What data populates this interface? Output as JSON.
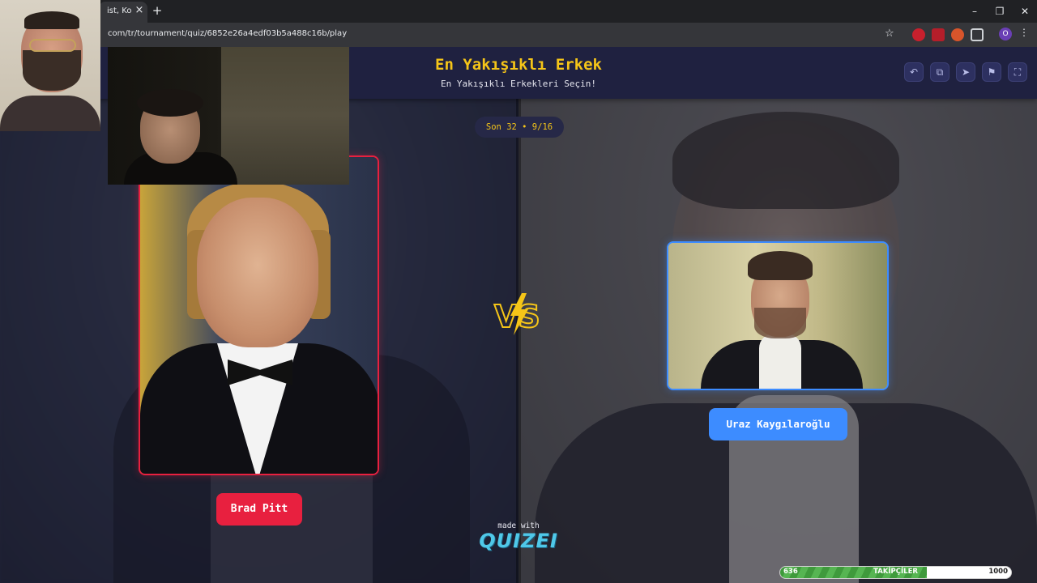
{
  "browser": {
    "tab_title": "ist, Ko",
    "tab_close": "×",
    "new_tab": "+",
    "url": "com/tr/tournament/quiz/6852e26a4edf03b5a488c16b/play",
    "window_controls": [
      "–",
      "❐",
      "✕"
    ]
  },
  "header": {
    "title": "En Yakışıklı Erkek",
    "subtitle": "En Yakışıklı Erkekleri Seçin!",
    "actions": [
      {
        "name": "undo-icon",
        "glyph": "↶"
      },
      {
        "name": "share-icon",
        "glyph": "⧉"
      },
      {
        "name": "send-icon",
        "glyph": "➤"
      },
      {
        "name": "flag-icon",
        "glyph": "⚑"
      },
      {
        "name": "fullscreen-icon",
        "glyph": "⛶"
      }
    ]
  },
  "round": {
    "label": "Son 32 • 9/16"
  },
  "matchup": {
    "left": {
      "name": "Brad Pitt",
      "accent": "#e8203f"
    },
    "right": {
      "name": "Uraz Kaygılaroğlu",
      "accent": "#3d8cff"
    },
    "vs": "VS"
  },
  "footer": {
    "made_with": "made with",
    "brand": "QUIZEI"
  },
  "followers_bar": {
    "current": "636",
    "label": "TAKİPÇİLER",
    "max": "1000",
    "progress": 0.636
  }
}
